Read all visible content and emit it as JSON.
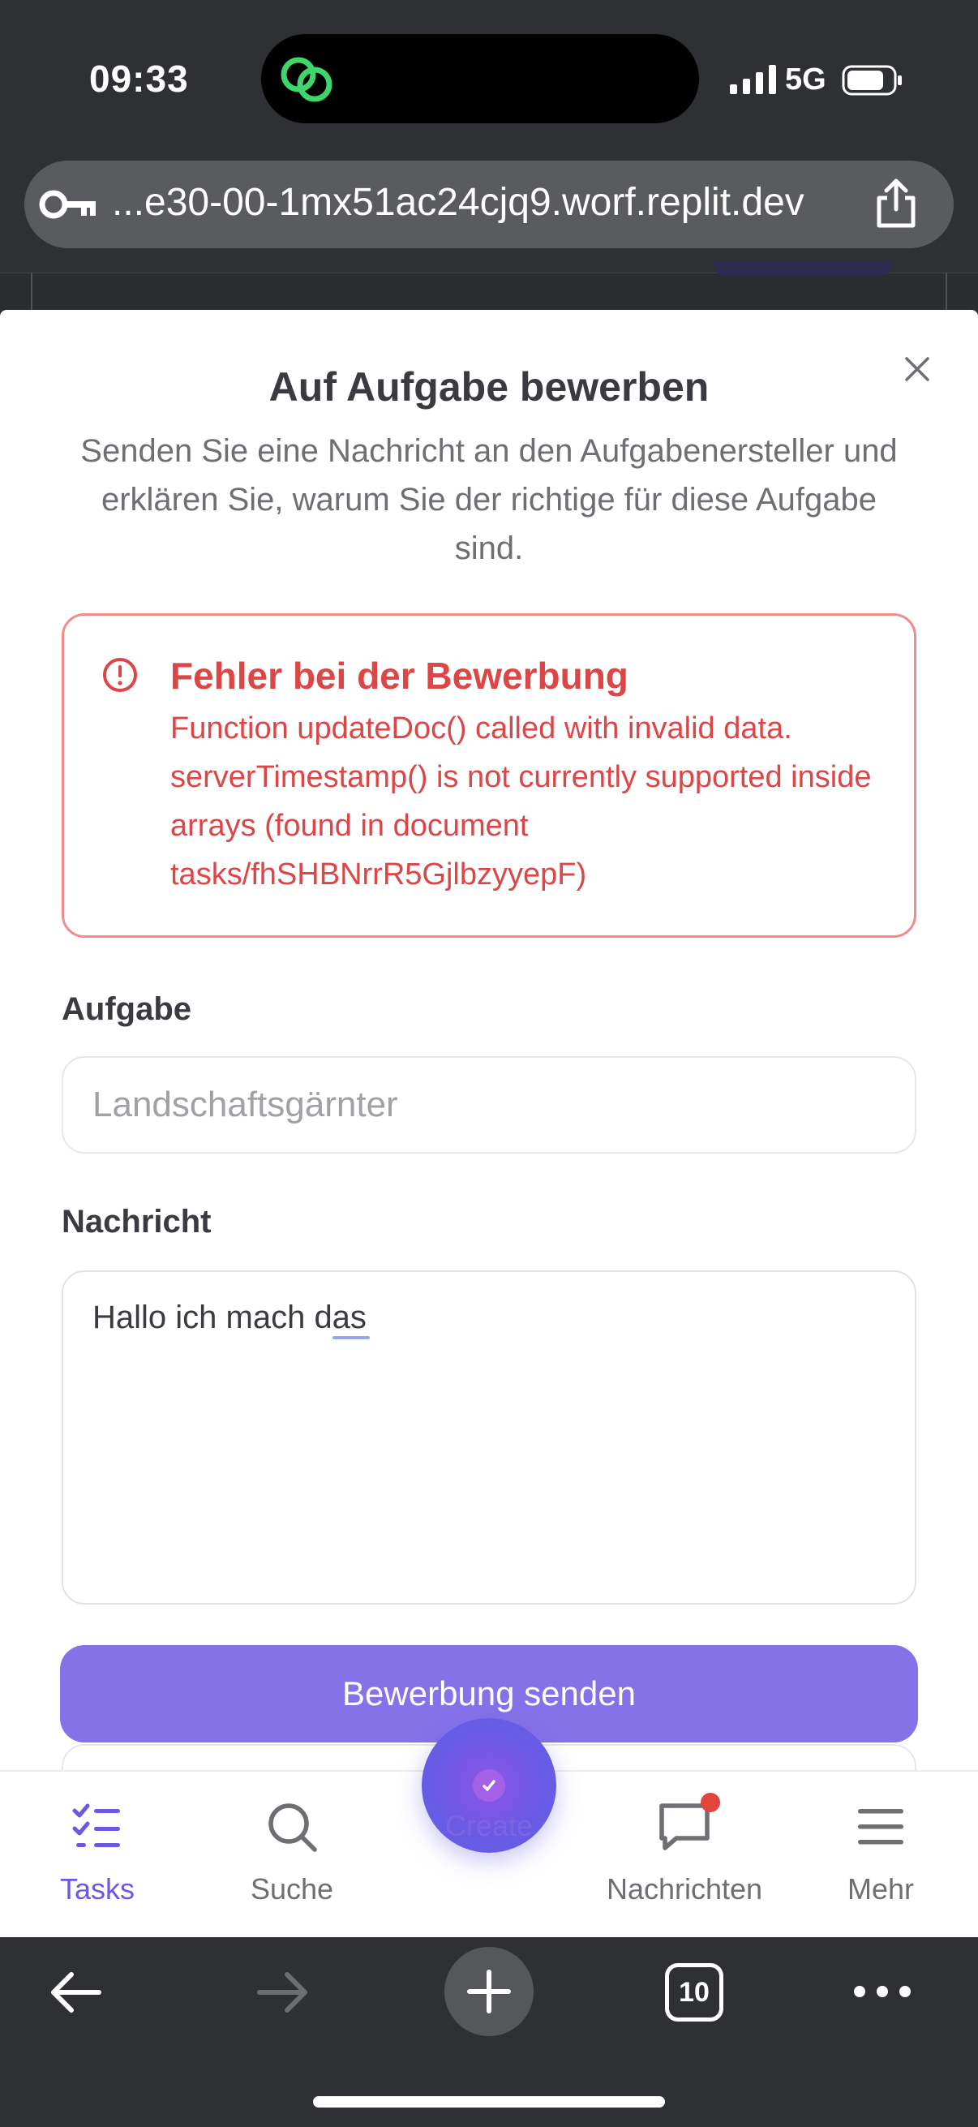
{
  "status_bar": {
    "time": "09:33",
    "network": "5G",
    "icons": [
      "link-icon",
      "signal-icon",
      "battery-icon"
    ]
  },
  "url_bar": {
    "url": "...e30-00-1mx51ac24cjq9.worf.replit.dev",
    "icons": [
      "key-icon",
      "share-icon"
    ]
  },
  "modal": {
    "title": "Auf Aufgabe bewerben",
    "description": "Senden Sie eine Nachricht an den Aufgabenersteller und erklären Sie, warum Sie der richtige für diese Aufgabe sind.",
    "error": {
      "title": "Fehler bei der Bewerbung",
      "message": "Function updateDoc() called with invalid data. serverTimestamp() is not currently supported inside arrays (found in document tasks/fhSHBNrrR5GjlbzyyepF)",
      "color": "#dc4646"
    },
    "task_field": {
      "label": "Aufgabe",
      "placeholder": "Landschaftsgärnter"
    },
    "message_field": {
      "label": "Nachricht",
      "value": "Hallo ich mach das"
    },
    "submit_label": "Bewerbung senden",
    "accent_color": "#8571e8"
  },
  "bottom_nav": {
    "items": [
      {
        "label": "Tasks",
        "icon": "tasks-icon",
        "active": true
      },
      {
        "label": "Suche",
        "icon": "search-icon",
        "active": false
      },
      {
        "label": "Create",
        "icon": "create-icon",
        "active": false
      },
      {
        "label": "Nachrichten",
        "icon": "chat-icon",
        "active": false,
        "badge": true
      },
      {
        "label": "Mehr",
        "icon": "menu-icon",
        "active": false
      }
    ],
    "active_color": "#6b5ae0"
  },
  "browser_toolbar": {
    "tab_count": "10",
    "icons": [
      "back-arrow-icon",
      "forward-arrow-icon",
      "new-tab-icon",
      "tabs-icon",
      "more-icon"
    ]
  }
}
